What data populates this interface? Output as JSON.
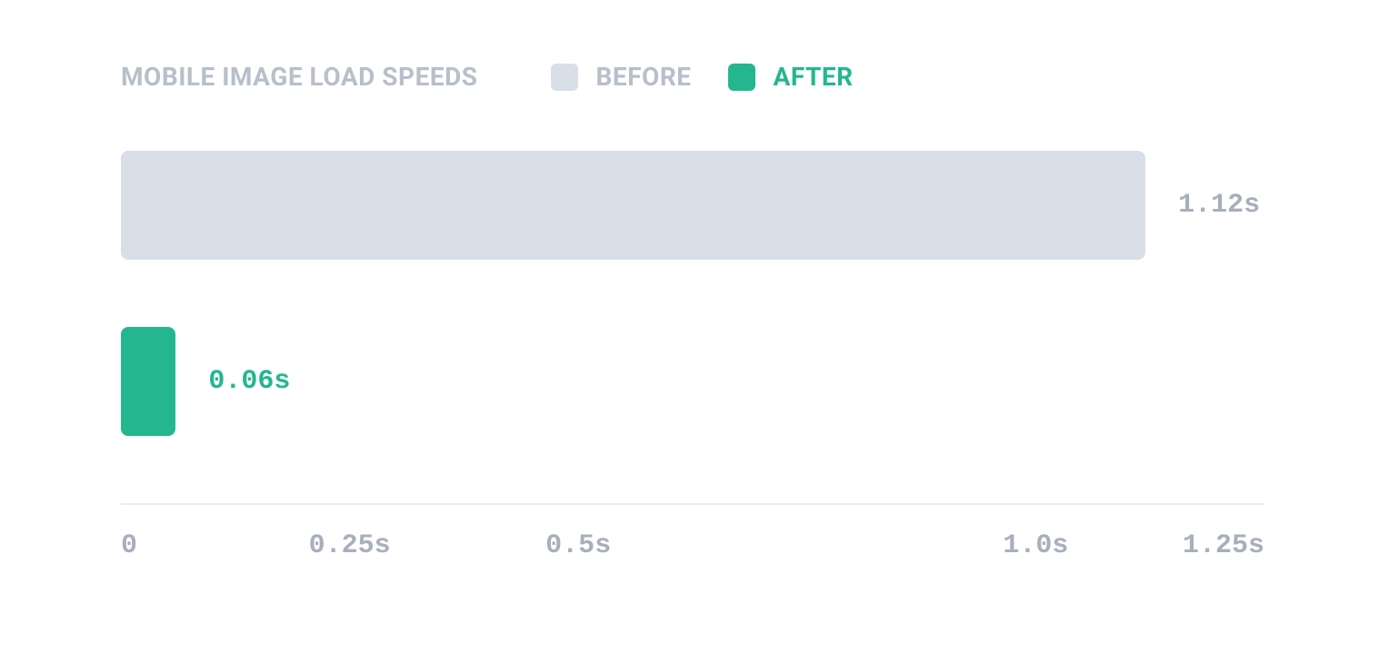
{
  "title": "MOBILE IMAGE LOAD SPEEDS",
  "legend": {
    "before": "BEFORE",
    "after": "AFTER"
  },
  "colors": {
    "before": "#d9dfe9",
    "after": "#24b78f",
    "muted_text": "#a8afbc",
    "title_text": "#b7bfca"
  },
  "bars": {
    "before": {
      "label": "1.12s",
      "value": 1.12
    },
    "after": {
      "label": "0.06s",
      "value": 0.06
    }
  },
  "axis": {
    "ticks": [
      "0",
      "0.25s",
      "0.5s",
      "1.0s",
      "1.25s"
    ],
    "tick_values": [
      0,
      0.25,
      0.5,
      1.0,
      1.25
    ],
    "max": 1.25
  },
  "chart_data": {
    "type": "bar",
    "orientation": "horizontal",
    "title": "MOBILE IMAGE LOAD SPEEDS",
    "categories": [
      "Before",
      "After"
    ],
    "values": [
      1.12,
      0.06
    ],
    "unit": "s",
    "xlabel": "",
    "ylabel": "",
    "xlim": [
      0,
      1.25
    ],
    "xticks": [
      0,
      0.25,
      0.5,
      1.0,
      1.25
    ],
    "series_colors": [
      "#d9dfe9",
      "#24b78f"
    ],
    "legend": [
      "BEFORE",
      "AFTER"
    ]
  }
}
